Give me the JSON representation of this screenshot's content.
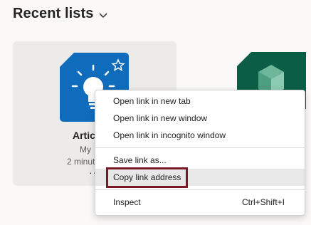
{
  "header": {
    "title": "Recent lists"
  },
  "card": {
    "title": "Articl",
    "subtitle": "My",
    "time": "2 minut",
    "more": "···"
  },
  "menu": {
    "items": [
      {
        "label": "Open link in new tab"
      },
      {
        "label": "Open link in new window"
      },
      {
        "label": "Open link in incognito window"
      },
      {
        "label": "Save link as..."
      },
      {
        "label": "Copy link address"
      },
      {
        "label": "Inspect",
        "shortcut": "Ctrl+Shift+I"
      }
    ]
  },
  "colors": {
    "card1_icon": "#0f6cbd",
    "card2_icon": "#0b5d45",
    "highlight_outline": "#7a1a26"
  },
  "icons": [
    "chevron-down-icon",
    "lightbulb-icon",
    "star-outline-icon",
    "cube-icon"
  ]
}
